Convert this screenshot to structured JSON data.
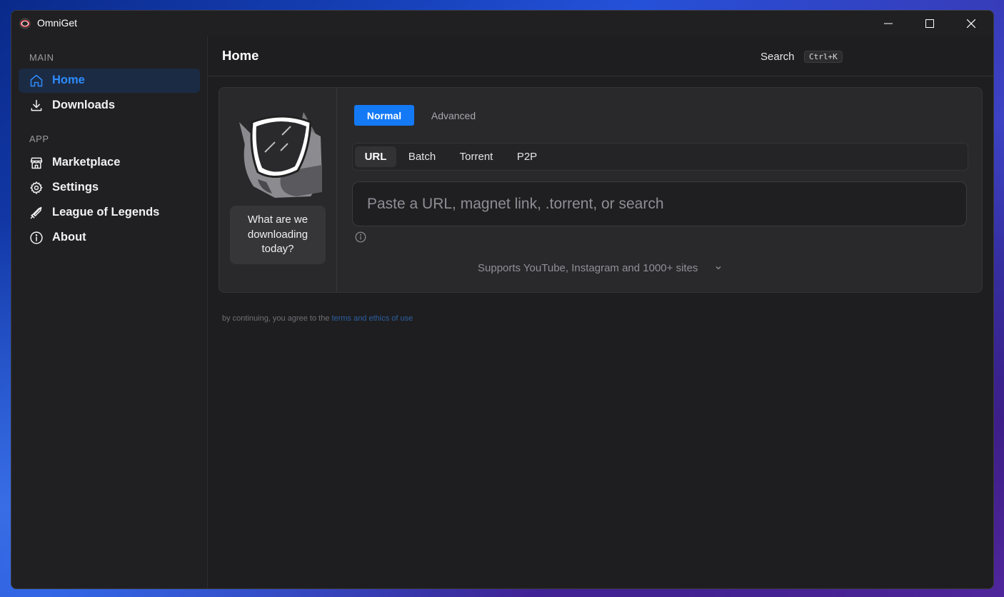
{
  "window": {
    "title": "OmniGet"
  },
  "sidebar": {
    "sections": [
      {
        "label": "MAIN"
      },
      {
        "label": "APP"
      }
    ],
    "items": [
      {
        "label": "Home",
        "icon": "home-icon",
        "active": true
      },
      {
        "label": "Downloads",
        "icon": "download-icon",
        "active": false
      },
      {
        "label": "Marketplace",
        "icon": "store-icon",
        "active": false
      },
      {
        "label": "Settings",
        "icon": "gear-icon",
        "active": false
      },
      {
        "label": "League of Legends",
        "icon": "sword-icon",
        "active": false
      },
      {
        "label": "About",
        "icon": "info-icon",
        "active": false
      }
    ]
  },
  "header": {
    "title": "Home",
    "search_label": "Search",
    "search_shortcut": "Ctrl+K"
  },
  "card": {
    "mascot_prompt": "What are we downloading today?",
    "modes": [
      {
        "label": "Normal",
        "active": true
      },
      {
        "label": "Advanced",
        "active": false
      }
    ],
    "tabs": [
      {
        "label": "URL",
        "active": true
      },
      {
        "label": "Batch",
        "active": false
      },
      {
        "label": "Torrent",
        "active": false
      },
      {
        "label": "P2P",
        "active": false
      }
    ],
    "input": {
      "value": "",
      "placeholder": "Paste a URL, magnet link, .torrent, or search"
    },
    "supports_text": "Supports YouTube, Instagram and 1000+ sites"
  },
  "footer": {
    "terms_prefix": "by continuing, you agree to the",
    "terms_link": "terms and ethics of use"
  },
  "colors": {
    "accent": "#1479f5",
    "active_nav_text": "#2d8cff",
    "active_nav_bg": "#1c2b44",
    "background": "#1e1e20"
  }
}
